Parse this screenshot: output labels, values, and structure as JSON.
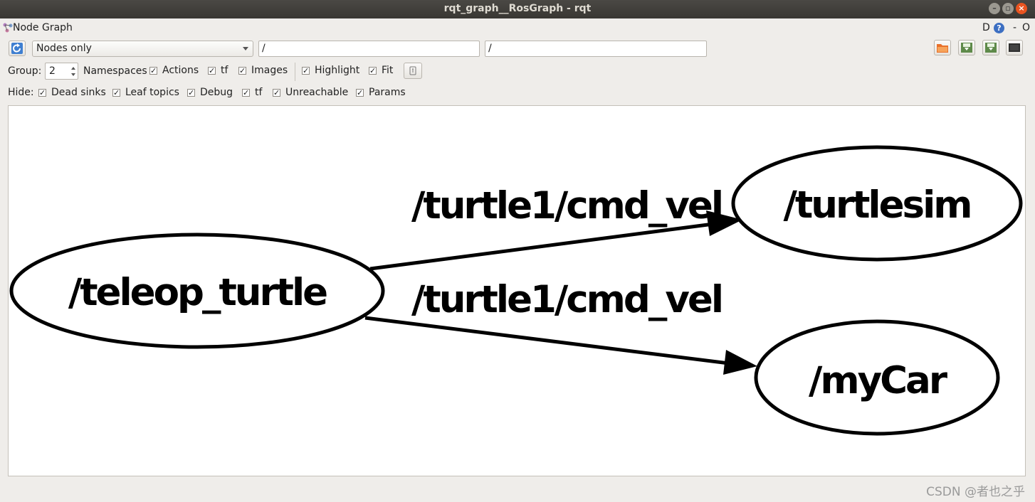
{
  "window": {
    "title": "rqt_graph__RosGraph - rqt"
  },
  "plugin": {
    "title": "Node Graph",
    "d_label": "D",
    "help_label": "?",
    "minimize_label": "-",
    "close_label": "O"
  },
  "toolbar": {
    "graph_type": "Nodes only",
    "include_filter": "/",
    "exclude_filter": "/"
  },
  "options": {
    "group_label": "Group:",
    "group_value": "2",
    "namespaces": "Namespaces",
    "actions": "Actions",
    "tf": "tf",
    "images": "Images",
    "highlight": "Highlight",
    "fit": "Fit"
  },
  "hide": {
    "label": "Hide:",
    "dead_sinks": "Dead sinks",
    "leaf_topics": "Leaf topics",
    "debug": "Debug",
    "tf": "tf",
    "unreachable": "Unreachable",
    "params": "Params"
  },
  "graph": {
    "nodes": {
      "teleop": "/teleop_turtle",
      "turtlesim": "/turtlesim",
      "mycar": "/myCar"
    },
    "edges": {
      "to_turtlesim": "/turtle1/cmd_vel",
      "to_mycar": "/turtle1/cmd_vel"
    }
  },
  "watermark": "CSDN @者也之乎",
  "colors": {
    "titlebar": "#3c3b37",
    "close_button": "#e95420",
    "window_bg": "#efedea"
  }
}
